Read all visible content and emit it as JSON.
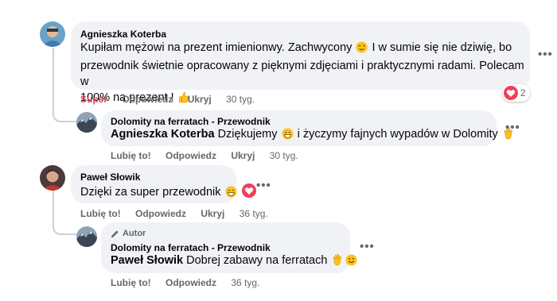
{
  "comments": [
    {
      "author": "Agnieszka Koterba",
      "text_l1a": "Kupiłam mężowi na prezent imienionwy. Zachwycony",
      "text_l1b": "I w sumie się nie dziwię, bo",
      "text_l2": "przewodnik świetnie opracowany z pięknymi zdjęciami i praktycznymi radami. Polecam w",
      "text_l3": "100% na prezent !",
      "reaction_label": "Super",
      "reply_label": "Odpowiedz",
      "hide_label": "Ukryj",
      "time": "30 tyg.",
      "reaction_count": "2",
      "more": "•••"
    },
    {
      "author": "Dolomity na ferratach - Przewodnik",
      "mention": "Agnieszka Koterba",
      "text_a": "Dziękujemy",
      "text_b": "i życzymy fajnych wypadów w Dolomity",
      "like_label": "Lubię to!",
      "reply_label": "Odpowiedz",
      "hide_label": "Ukryj",
      "time": "30 tyg.",
      "more": "•••"
    },
    {
      "author": "Paweł Słowik",
      "text": "Dzięki za super przewodnik",
      "like_label": "Lubię to!",
      "reply_label": "Odpowiedz",
      "hide_label": "Ukryj",
      "time": "36 tyg.",
      "more": "•••"
    },
    {
      "badge": "Autor",
      "author": "Dolomity na ferratach - Przewodnik",
      "mention": "Paweł Słowik",
      "text": "Dobrej zabawy na ferratach",
      "like_label": "Lubię to!",
      "reply_label": "Odpowiedz",
      "time": "36 tyg.",
      "more": "•••"
    }
  ],
  "colors": {
    "bubble": "#f0f2f5",
    "secondary_text": "#65676b",
    "super_reaction": "#e4405c",
    "heart": "#f33e58"
  },
  "icons": [
    "wink-emoji",
    "thumbs-up-emoji",
    "grin-emoji",
    "waving-hand-emoji",
    "smile-emoji",
    "heart-reaction-icon",
    "pencil-icon"
  ]
}
